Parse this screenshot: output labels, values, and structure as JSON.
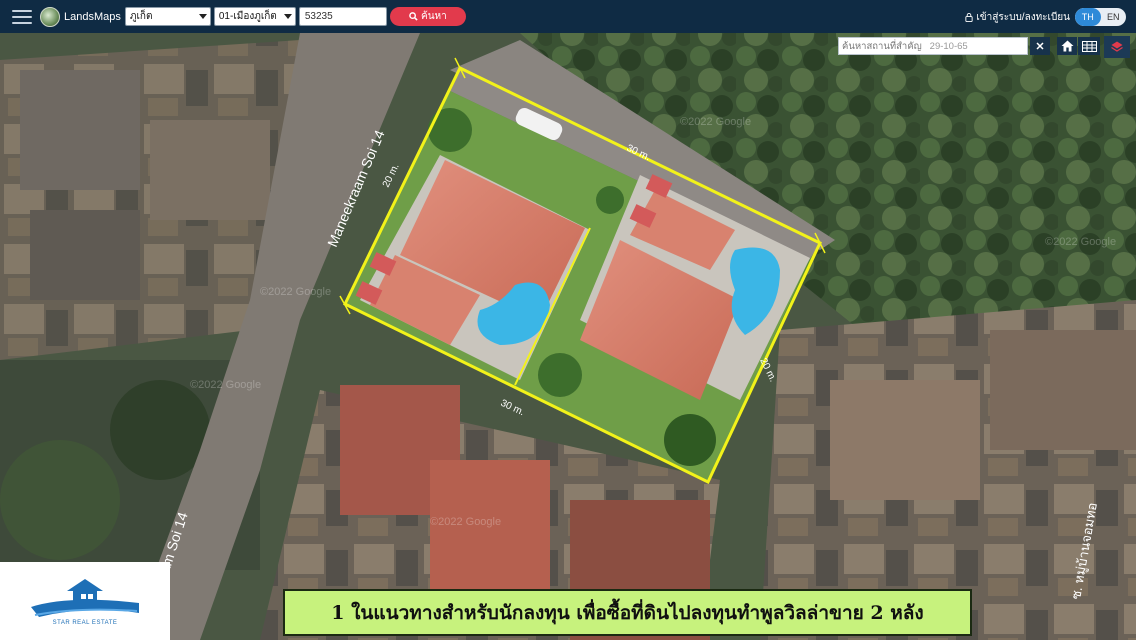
{
  "app": {
    "name": "LandsMaps"
  },
  "toolbar": {
    "province_value": "ภูเก็ต",
    "district_value": "01-เมืองภูเก็ต",
    "parcel_value": "53235",
    "search_label": "ค้นหา",
    "login_label": "เข้าสู่ระบบ/ลงทะเบียน",
    "lang_th": "TH",
    "lang_en": "EN"
  },
  "map_search": {
    "placeholder": "ค้นหาสถานที่สำคัญ",
    "value": "29-10-65"
  },
  "map": {
    "road_label_1": "Maneekraam Soi 14",
    "road_label_2": "ekraam Soi 14",
    "road_label_3": "ซ. หมู่บ้านจอมทอ",
    "dim_top": "30 m.",
    "dim_bottom": "30 m.",
    "dim_left": "20 m.",
    "dim_right": "20 m.",
    "watermarks": [
      "©2022 Google",
      "©2022 Google",
      "©2022 Google",
      "©2022 Google",
      "©2022 Google"
    ],
    "plot_outline_color": "#f2f21a"
  },
  "brand": {
    "name": "STAR REAL ESTATE",
    "color": "#1e6fb6"
  },
  "caption": {
    "text": "1 ในแนวทางสำหรับนักลงทุน เพื่อซื้อที่ดินไปลงทุนทำพูลวิลล่าขาย 2 หลัง",
    "bg": "#c7f27d"
  },
  "icons": {
    "menu": "hamburger-icon",
    "search": "search-icon",
    "lock": "lock-icon",
    "clear": "close-icon",
    "home": "home-icon",
    "grid": "grid-icon",
    "layers": "layers-icon"
  }
}
